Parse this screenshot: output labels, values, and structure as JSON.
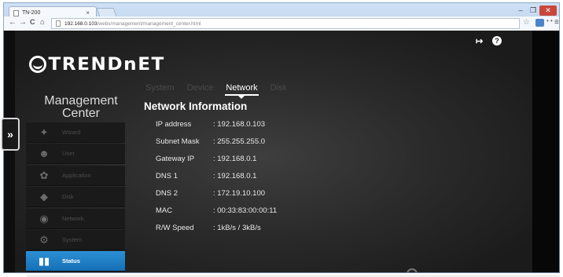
{
  "browser": {
    "tab_title": "TN-200",
    "tab_close": "×",
    "url_host": "192.168.0.103",
    "url_path": "/webs/management/management_center.html",
    "back": "←",
    "forward": "→",
    "reload": "C",
    "home": "⌂",
    "minimize": "–",
    "maximize": "❐",
    "close": "✕",
    "star": "☆",
    "menu": "≡",
    "ext2": "• •"
  },
  "header": {
    "logo_text": "TRENDnET",
    "logout": "↦",
    "help": "?"
  },
  "sidebar": {
    "title": "Management Center",
    "collapse": "»",
    "items": [
      {
        "label": "Wizard",
        "icon": "wizard-icon",
        "glyph": "✦",
        "active": false
      },
      {
        "label": "User",
        "icon": "user-icon",
        "glyph": "☻",
        "active": false
      },
      {
        "label": "Application",
        "icon": "application-icon",
        "glyph": "✿",
        "active": false
      },
      {
        "label": "Disk",
        "icon": "disk-icon",
        "glyph": "◆",
        "active": false
      },
      {
        "label": "Network",
        "icon": "network-icon",
        "glyph": "◉",
        "active": false
      },
      {
        "label": "System",
        "icon": "system-icon",
        "glyph": "⚙",
        "active": false
      },
      {
        "label": "Status",
        "icon": "status-icon",
        "glyph": "▮▮",
        "active": true
      }
    ]
  },
  "tabs": [
    {
      "label": "System",
      "active": false
    },
    {
      "label": "Device",
      "active": false
    },
    {
      "label": "Network",
      "active": true
    },
    {
      "label": "Disk",
      "active": false
    }
  ],
  "section_title": "Network Information",
  "network_info": [
    {
      "key": "IP address",
      "value": ": 192.168.0.103"
    },
    {
      "key": "Subnet Mask",
      "value": ": 255.255.255.0"
    },
    {
      "key": "Gateway IP",
      "value": ": 192.168.0.1"
    },
    {
      "key": "DNS 1",
      "value": ": 192.168.0.1"
    },
    {
      "key": "DNS 2",
      "value": ": 172.19.10.100"
    },
    {
      "key": "MAC",
      "value": ": 00:33:83:00:00:11"
    },
    {
      "key": "R/W Speed",
      "value": ": 1kB/s / 3kB/s"
    }
  ]
}
